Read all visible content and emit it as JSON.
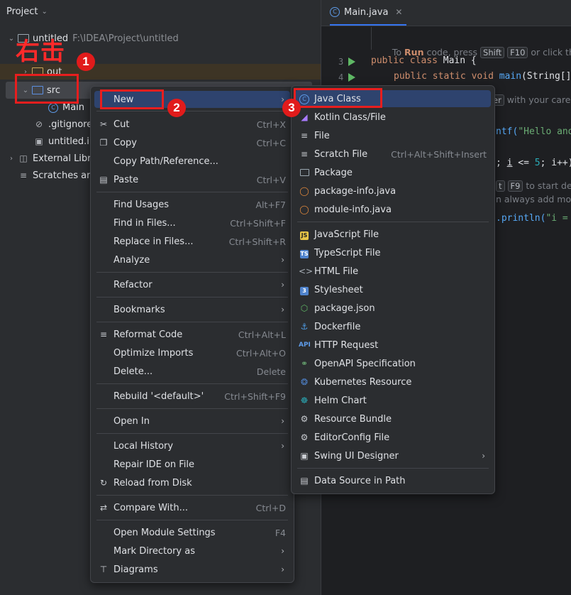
{
  "project_panel": {
    "title": "Project",
    "tree": {
      "root_name": "untitled",
      "root_path": "F:\\IDEA\\Project\\untitled",
      "out": "out",
      "src": "src",
      "main": "Main",
      "gitignore": ".gitignore",
      "iml": "untitled.iml",
      "external": "External Libraries",
      "scratches": "Scratches and Consoles"
    }
  },
  "editor": {
    "tab_label": "Main.java",
    "line_numbers": [
      "3",
      "4"
    ],
    "hint1": {
      "a": "To ",
      "run": "Run",
      "b": " code, press ",
      "k1": "Shift",
      "k2": "F10",
      "c": " or click the"
    },
    "code3": {
      "k1": "public",
      "k2": "class",
      "name": "Main {"
    },
    "code4": {
      "k1": "public",
      "k2": "static",
      "k3": "void",
      "fn": "main",
      "rest": "(String[]"
    },
    "hint_caret": {
      "a": "er",
      "b": " with your care"
    },
    "code_printf": {
      "a": "ntf(",
      "s": "\"Hello and"
    },
    "code_loop": {
      "a": "; ",
      "i": "i",
      "b": " <= ",
      "n": "5",
      "c": "; i++)"
    },
    "hint_debug": {
      "a": "t",
      "k": "F9",
      "b": " to start de"
    },
    "hint_bp": "n always add mor",
    "code_println": {
      "a": ".println(",
      "s": "\"i = "
    }
  },
  "annotations": {
    "label": "右击",
    "badges": [
      "1",
      "2",
      "3"
    ]
  },
  "context_menu": {
    "new": "New",
    "cut": "Cut",
    "cut_sc": "Ctrl+X",
    "copy": "Copy",
    "copy_sc": "Ctrl+C",
    "copy_path": "Copy Path/Reference...",
    "paste": "Paste",
    "paste_sc": "Ctrl+V",
    "find_usages": "Find Usages",
    "find_usages_sc": "Alt+F7",
    "find_in_files": "Find in Files...",
    "find_in_files_sc": "Ctrl+Shift+F",
    "replace_in_files": "Replace in Files...",
    "replace_in_files_sc": "Ctrl+Shift+R",
    "analyze": "Analyze",
    "refactor": "Refactor",
    "bookmarks": "Bookmarks",
    "reformat": "Reformat Code",
    "reformat_sc": "Ctrl+Alt+L",
    "optimize": "Optimize Imports",
    "optimize_sc": "Ctrl+Alt+O",
    "delete": "Delete...",
    "delete_sc": "Delete",
    "rebuild": "Rebuild '<default>'",
    "rebuild_sc": "Ctrl+Shift+F9",
    "open_in": "Open In",
    "local_history": "Local History",
    "repair": "Repair IDE on File",
    "reload": "Reload from Disk",
    "compare": "Compare With...",
    "compare_sc": "Ctrl+D",
    "module_settings": "Open Module Settings",
    "module_settings_sc": "F4",
    "mark_dir": "Mark Directory as",
    "diagrams": "Diagrams"
  },
  "new_submenu": {
    "java_class": "Java Class",
    "kotlin": "Kotlin Class/File",
    "file": "File",
    "scratch": "Scratch File",
    "scratch_sc": "Ctrl+Alt+Shift+Insert",
    "package": "Package",
    "package_info": "package-info.java",
    "module_info": "module-info.java",
    "js": "JavaScript File",
    "ts": "TypeScript File",
    "html": "HTML File",
    "stylesheet": "Stylesheet",
    "package_json": "package.json",
    "dockerfile": "Dockerfile",
    "http": "HTTP Request",
    "openapi": "OpenAPI Specification",
    "k8s": "Kubernetes Resource",
    "helm": "Helm Chart",
    "resource_bundle": "Resource Bundle",
    "editorconfig": "EditorConfig File",
    "swing": "Swing UI Designer",
    "datasource": "Data Source in Path"
  }
}
